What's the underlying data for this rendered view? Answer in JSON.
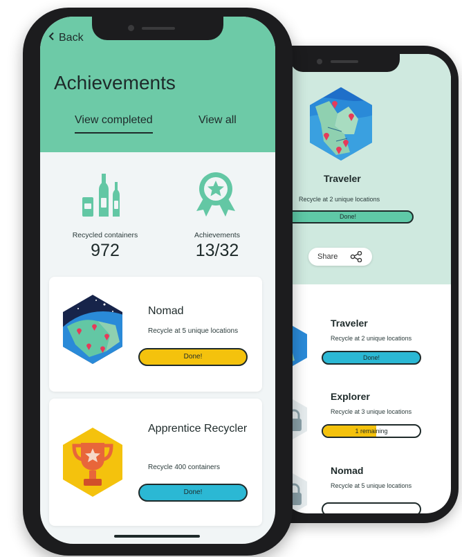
{
  "colors": {
    "header_green": "#6dcaa7",
    "mint_light": "#cfe9df",
    "done_yellow": "#f4c20d",
    "done_cyan": "#2bb8d4",
    "done_green": "#5fc9a7",
    "text_dark": "#1e2a2a"
  },
  "front": {
    "header": {
      "back_label": "Back",
      "title": "Achievements",
      "tabs": [
        {
          "label": "View completed",
          "active": true
        },
        {
          "label": "View all",
          "active": false
        }
      ]
    },
    "stats": [
      {
        "icon": "bottles-icon",
        "label": "Recycled containers",
        "value": "972"
      },
      {
        "icon": "award-ribbon-icon",
        "label": "Achievements",
        "value": "13/32"
      }
    ],
    "cards": [
      {
        "icon": "globe-hexagon-badge-icon",
        "title": "Nomad",
        "description": "Recycle at 5 unique locations",
        "status": "Done!",
        "status_color": "#f4c20d"
      },
      {
        "icon": "trophy-hexagon-badge-icon",
        "title": "Apprentice Recycler",
        "description": "Recycle 400 containers",
        "status": "Done!",
        "status_color": "#2bb8d4"
      }
    ]
  },
  "back": {
    "hero": {
      "icon": "map-hexagon-badge-icon",
      "title": "Traveler",
      "description": "Recycle at 2 unique locations",
      "status": "Done!",
      "share_label": "Share"
    },
    "list": [
      {
        "icon": "map-hexagon-badge-icon",
        "title": "Traveler",
        "description": "Recycle at 2 unique locations",
        "status": "Done!"
      },
      {
        "icon": "lock-hexagon-badge-icon",
        "title": "Explorer",
        "description": "Recycle at 3 unique locations",
        "status": "1 remaining",
        "progress": 0.55
      },
      {
        "icon": "lock-hexagon-badge-icon",
        "title": "Nomad",
        "description": "Recycle at 5 unique locations"
      }
    ]
  }
}
